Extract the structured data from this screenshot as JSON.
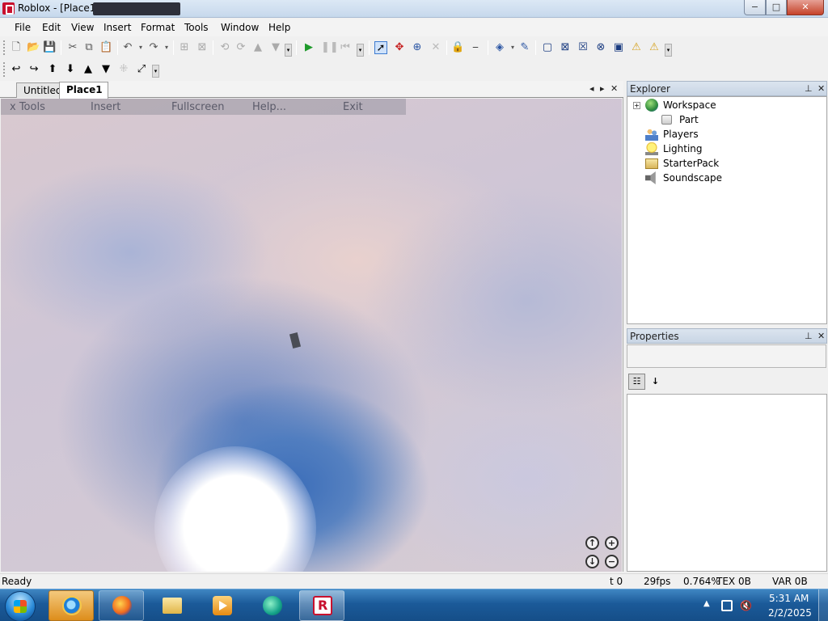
{
  "window": {
    "title": "Roblox - [Place1]",
    "controls": {
      "minimize": "−",
      "maximize": "□",
      "close": "✕"
    }
  },
  "menu": [
    "File",
    "Edit",
    "View",
    "Insert",
    "Format",
    "Tools",
    "Window",
    "Help"
  ],
  "document_tabs": [
    {
      "label": "Untitled",
      "active": false
    },
    {
      "label": "Place1",
      "active": true
    }
  ],
  "ingame_menu": [
    "x Tools",
    "Insert",
    "Fullscreen",
    "Help...",
    "Exit"
  ],
  "explorer": {
    "title": "Explorer",
    "items": [
      {
        "label": "Workspace",
        "icon": "globe-icon",
        "expandable": true
      },
      {
        "label": "Part",
        "icon": "part-icon",
        "child": true
      },
      {
        "label": "Players",
        "icon": "players-icon"
      },
      {
        "label": "Lighting",
        "icon": "lightbulb-icon"
      },
      {
        "label": "StarterPack",
        "icon": "backpack-icon"
      },
      {
        "label": "Soundscape",
        "icon": "speaker-icon"
      }
    ]
  },
  "properties": {
    "title": "Properties"
  },
  "status": {
    "left": "Ready",
    "t": "t 0",
    "fps": "29fps",
    "pct": "0.764%",
    "tex": "TEX 0B",
    "var": "VAR 0B"
  },
  "taskbar": {
    "time": "5:31 AM",
    "date": "2/2/2025",
    "apps": [
      "internet-explorer",
      "firefox",
      "file-explorer",
      "media-center",
      "windows-media-player",
      "roblox"
    ]
  }
}
